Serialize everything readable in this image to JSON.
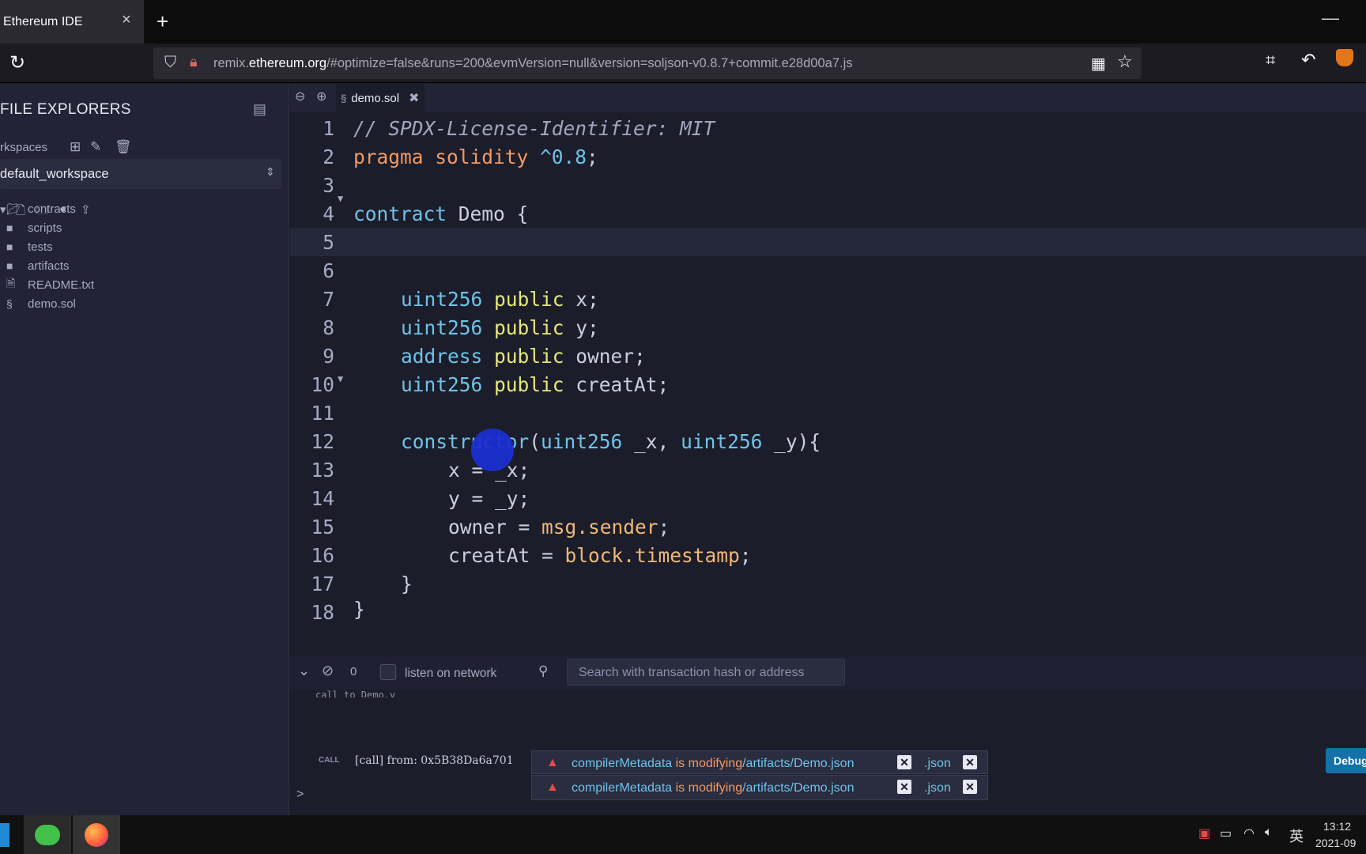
{
  "browser": {
    "tab_title": "Ethereum IDE",
    "tab_close": "×",
    "new_tab": "+",
    "minimize": "—",
    "url_prefix": "remix.",
    "url_domain": "ethereum.org",
    "url_rest": "/#optimize=false&runs=200&evmVersion=null&version=soljson-v0.8.7+commit.e28d00a7.js"
  },
  "file_explorer": {
    "title": "FILE EXPLORERS",
    "workspaces_label": "rkspaces",
    "workspace_selected": "default_workspace",
    "items": [
      {
        "name": "contracts",
        "icon": "folder-open-icon"
      },
      {
        "name": "scripts",
        "icon": "folder-icon"
      },
      {
        "name": "tests",
        "icon": "folder-icon"
      },
      {
        "name": "artifacts",
        "icon": "folder-icon"
      },
      {
        "name": "README.txt",
        "icon": "file-icon"
      },
      {
        "name": "demo.sol",
        "icon": "solidity-icon"
      }
    ]
  },
  "editor": {
    "tab_name": "demo.sol",
    "line_numbers": [
      "1",
      "2",
      "3",
      "4",
      "5",
      "6",
      "7",
      "8",
      "9",
      "10",
      "11",
      "12",
      "13",
      "14",
      "15",
      "16",
      "17",
      "18"
    ]
  },
  "code": {
    "l1": "// SPDX-License-Identifier: MIT",
    "l2_kw": "pragma solidity",
    "l2_ver": "^0.8",
    "l2_end": ";",
    "l4_kw": "contract",
    "l4_rest": " Demo {",
    "t_uint": "uint256",
    "t_address": "address",
    "kw_public": "public",
    "l6_rest": " x;",
    "l7_rest": " y;",
    "l8_rest": " owner;",
    "l9_rest": " creatAt;",
    "l11_ctor": "constructor",
    "l11_a": "(",
    "l11_b": " _x, ",
    "l11_c": " _y){",
    "l12": "x = _x;",
    "l13": "y = _y;",
    "l14_a": "owner = ",
    "l14_b": "msg.sender",
    "l14_c": ";",
    "l15_a": "creatAt = ",
    "l15_b": "block.timestamp",
    "l15_c": ";",
    "l16": "}",
    "l18": "}"
  },
  "terminal": {
    "count": "0",
    "listen_label": "listen on network",
    "search_placeholder": "Search with transaction hash or address",
    "partial_line": "call to Demo.y",
    "call_badge": "CALL",
    "call_text": "[call] from: 0x5B38Da6a701",
    "prompt": ">",
    "debug_label": "Debug"
  },
  "toasts": [
    {
      "m1": "compilerMetadata",
      "m2": " is modifying",
      "m3": "/artifacts/Demo.json",
      "tail": ".json"
    },
    {
      "m1": "compilerMetadata",
      "m2": " is modifying",
      "m3": "/artifacts/Demo.json",
      "tail": ".json"
    }
  ],
  "taskbar": {
    "ime": "英",
    "time": "13:12",
    "date": "2021-09"
  }
}
